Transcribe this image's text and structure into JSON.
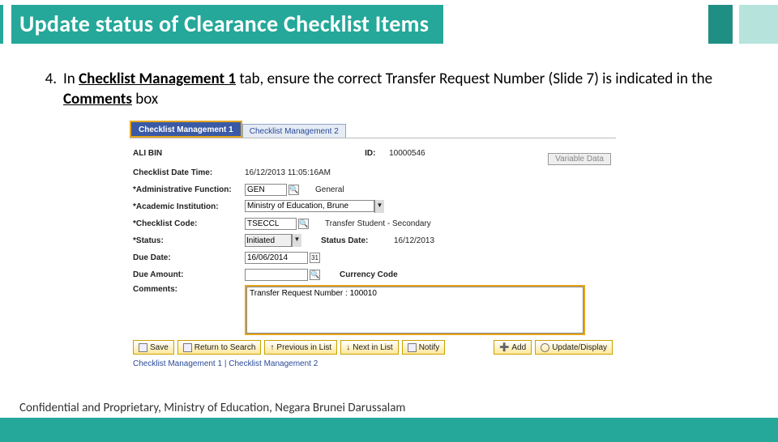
{
  "header": {
    "title": "Update status of Clearance Checklist Items"
  },
  "step": {
    "num": "4.",
    "prefix": "In ",
    "tab_name": "Checklist Management 1",
    "mid": " tab, ensure the correct Transfer Request Number (Slide 7) is indicated in the ",
    "comments": "Comments",
    "suffix": " box"
  },
  "tabs": {
    "tab1": "Checklist Management 1",
    "tab2": "Checklist Management 2"
  },
  "student": {
    "name": "ALI BIN",
    "id_label": "ID:",
    "id": "10000546"
  },
  "labels": {
    "datetime": "Checklist Date Time:",
    "admin_fn": "Administrative Function:",
    "acad_inst": "Academic Institution:",
    "chk_code": "Checklist Code:",
    "status": "Status:",
    "status_date": "Status Date:",
    "due_date": "Due Date:",
    "due_amount": "Due Amount:",
    "currency": "Currency Code",
    "comments": "Comments:",
    "variable_data": "Variable Data"
  },
  "values": {
    "datetime": "16/12/2013 11:05:16AM",
    "admin_fn": "GEN",
    "admin_fn_desc": "General",
    "acad_inst": "Ministry of Education, Brune",
    "chk_code": "TSECCL",
    "chk_code_desc": "Transfer Student - Secondary",
    "status": "Initiated",
    "status_date": "16/12/2013",
    "due_date": "16/06/2014",
    "due_amount": "",
    "comments_text": "Transfer Request Number : 100010"
  },
  "buttons": {
    "save": "Save",
    "return": "Return to Search",
    "prev": "Previous in List",
    "next": "Next in List",
    "notify": "Notify",
    "add": "Add",
    "update": "Update/Display"
  },
  "tablinks": {
    "t1": "Checklist Management 1",
    "t2": "Checklist Management 2"
  },
  "footer": "Confidential and Proprietary, Ministry of Education, Negara Brunei Darussalam"
}
